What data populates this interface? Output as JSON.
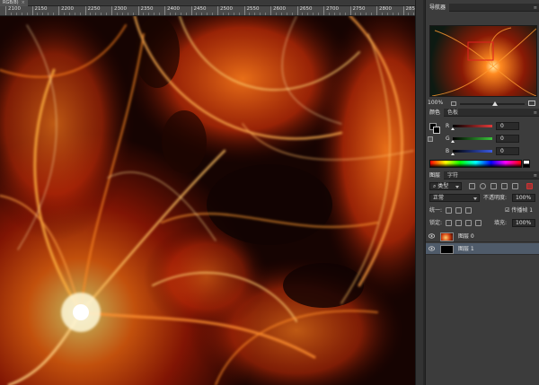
{
  "document": {
    "tab_title": "RGB/8)",
    "ruler_labels": [
      "2100",
      "2150",
      "2200",
      "2250",
      "2300",
      "2350",
      "2400",
      "2450",
      "2500",
      "2550",
      "2600",
      "2650",
      "2700",
      "2750",
      "2800",
      "2850"
    ]
  },
  "navigator": {
    "tab": "导航器",
    "zoom": "100%"
  },
  "color_panel": {
    "tabs": [
      "颜色",
      "色板"
    ],
    "channels": [
      {
        "label": "R",
        "value": "0",
        "color": "#e23a3a"
      },
      {
        "label": "G",
        "value": "0",
        "color": "#3ac43a"
      },
      {
        "label": "B",
        "value": "0",
        "color": "#3a5ae2"
      }
    ]
  },
  "layers_panel": {
    "tabs": [
      "图层",
      "字符"
    ],
    "filter_kind": "类型",
    "blend_mode": "正常",
    "opacity_label": "不透明度:",
    "opacity_value": "100%",
    "unify_label": "统一:",
    "propagate_label": "传播帧 1",
    "lock_label": "锁定:",
    "fill_label": "填充:",
    "fill_value": "100%",
    "layers": [
      {
        "name": "图层 0",
        "selected": false
      },
      {
        "name": "图层 1",
        "selected": true
      }
    ]
  },
  "colors": {
    "panel_bg": "#3c3c3c",
    "header_bg": "#2c2c2c",
    "selection": "#4f5b6a",
    "flame_core": "#fff6c8",
    "flame_orange": "#ff6a10",
    "flame_red": "#c41a05"
  },
  "icons": [
    "close-icon",
    "panel-menu-icon",
    "eye-icon",
    "lock-icon",
    "filter-icon",
    "swatch-icon"
  ]
}
